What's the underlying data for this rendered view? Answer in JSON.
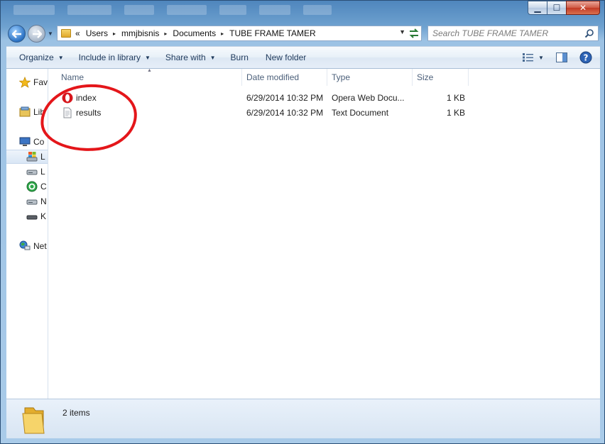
{
  "window": {
    "minimize_glyph": "▁",
    "maximize_glyph": "☐",
    "close_glyph": "✕"
  },
  "address": {
    "prefix": "«",
    "crumbs": [
      "Users",
      "mmjbisnis",
      "Documents",
      "TUBE FRAME TAMER"
    ],
    "separator": "▸"
  },
  "search": {
    "placeholder": "Search TUBE FRAME TAMER"
  },
  "toolbar": {
    "organize": "Organize",
    "include_in_library": "Include in library",
    "share_with": "Share with",
    "burn": "Burn",
    "new_folder": "New folder",
    "dropdown_arrow": "▼"
  },
  "nav": {
    "items": [
      {
        "label": "Fav",
        "icon": "star-icon"
      },
      {
        "label": "Lib",
        "icon": "library-icon"
      },
      {
        "label": "Co",
        "icon": "computer-icon"
      },
      {
        "label": "L",
        "icon": "windows-drive-icon",
        "selected": true
      },
      {
        "label": "L",
        "icon": "drive-icon"
      },
      {
        "label": "C",
        "icon": "recycle-drive-icon"
      },
      {
        "label": "N",
        "icon": "drive-icon"
      },
      {
        "label": "K",
        "icon": "removable-drive-icon"
      },
      {
        "label": "Net",
        "icon": "network-icon"
      }
    ]
  },
  "columns": {
    "name": "Name",
    "date_modified": "Date modified",
    "type": "Type",
    "size": "Size"
  },
  "files": [
    {
      "name": "index",
      "date": "6/29/2014 10:32 PM",
      "type": "Opera Web Docu...",
      "size": "1 KB",
      "icon": "opera-icon"
    },
    {
      "name": "results",
      "date": "6/29/2014 10:32 PM",
      "type": "Text Document",
      "size": "1 KB",
      "icon": "text-document-icon"
    }
  ],
  "status": {
    "item_count": "2 items"
  },
  "colors": {
    "annotation": "#e4161a",
    "toolbar_text": "#1e395b"
  }
}
